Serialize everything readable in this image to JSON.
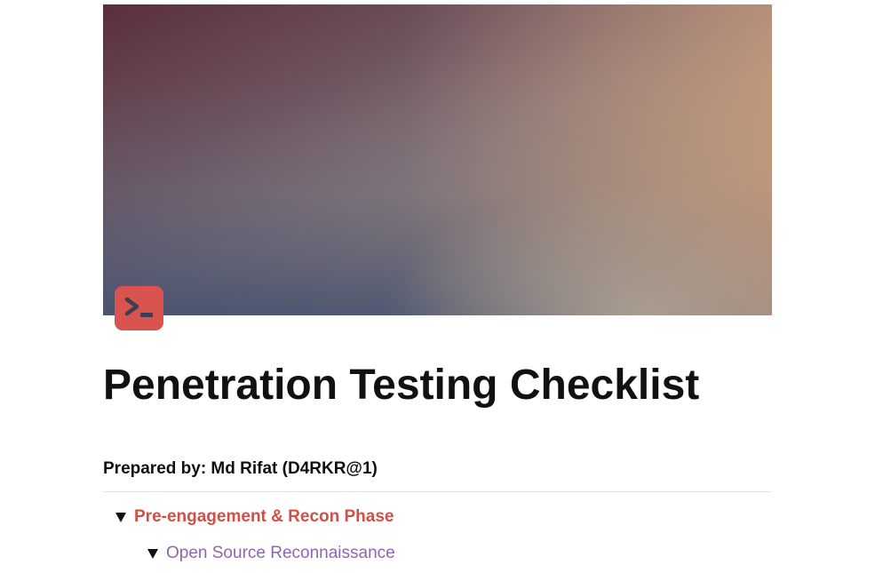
{
  "document": {
    "title": "Penetration Testing Checklist",
    "prepared_by": "Prepared by: Md Rifat (D4RKR@1)",
    "icon": "terminal-prompt-icon",
    "colors": {
      "icon_bg": "#d9534f",
      "phase_text": "#d24f45",
      "subsection_text": "#9065b0"
    }
  },
  "toggles": [
    {
      "label": "Pre-engagement & Recon Phase",
      "expanded": true,
      "children": [
        {
          "label": "Open Source Reconnaissance",
          "expanded": true
        }
      ]
    }
  ]
}
